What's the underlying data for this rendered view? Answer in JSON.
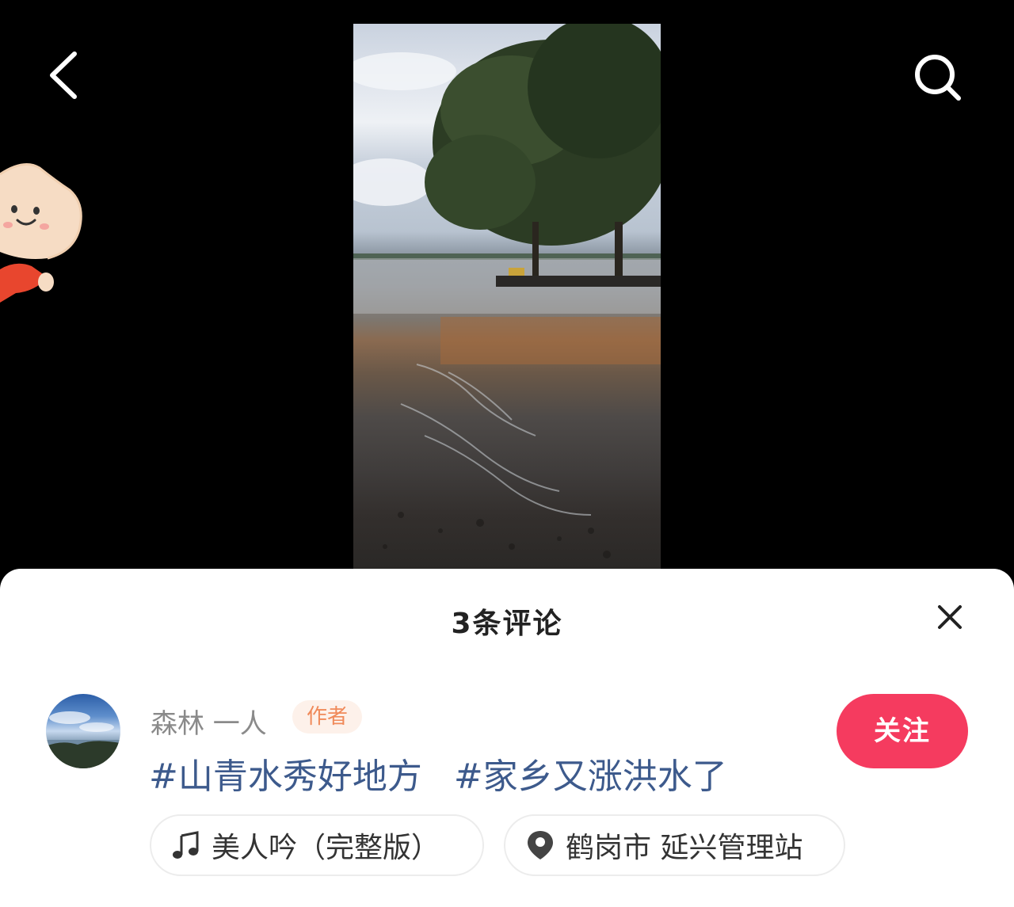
{
  "comments": {
    "title": "3条评论"
  },
  "post": {
    "author_name": "森林 一人",
    "author_badge": "作者",
    "hashtags": [
      "#山青水秀好地方",
      "#家乡又涨洪水了"
    ],
    "follow_label": "关注",
    "music": "美人吟（完整版）",
    "location": "鹤岗市 延兴管理站"
  },
  "icons": {
    "back": "chevron-left-icon",
    "search": "search-icon",
    "close": "close-icon",
    "music": "music-note-icon",
    "location": "location-pin-icon"
  },
  "colors": {
    "follow_button": "#f53b5f",
    "hashtag": "#3d5a8c",
    "badge_text": "#f08a5a",
    "badge_bg": "#fdf1ea"
  }
}
